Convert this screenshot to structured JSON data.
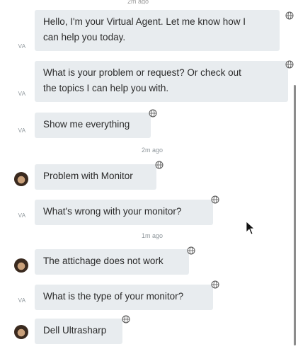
{
  "chat": {
    "top_timestamp": "2m ago",
    "messages": [
      {
        "from": "VA",
        "text_lines": [
          "Hello, I'm your Virtual Agent. Let me know how I",
          "can help you today."
        ]
      },
      {
        "from": "VA",
        "text_lines": [
          "What is your problem or request? Or check out",
          "the topics I can help you with."
        ]
      },
      {
        "from": "VA",
        "text": "Show me everything"
      },
      {
        "timestamp": "2m ago"
      },
      {
        "from": "user",
        "text": "Problem with Monitor"
      },
      {
        "from": "VA",
        "text": "What's wrong with your monitor?"
      },
      {
        "timestamp": "1m ago"
      },
      {
        "from": "user",
        "text": "The attichage does not work"
      },
      {
        "from": "VA",
        "text": "What is the type of your monitor?"
      },
      {
        "from": "user",
        "text": "Dell Ultrasharp"
      }
    ]
  },
  "icons": {
    "translate": "globe-icon",
    "avatar": "user-avatar"
  },
  "colors": {
    "bubble": "#e8ecef",
    "meta_text": "#8f979c",
    "scrollbar": "#8c8c8c"
  }
}
